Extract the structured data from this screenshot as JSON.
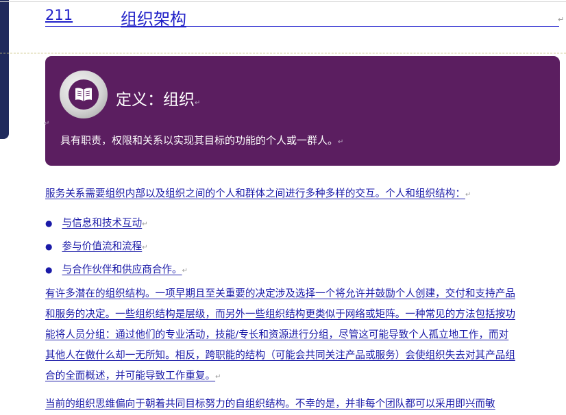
{
  "section": {
    "number": "211",
    "title": "组织架构"
  },
  "definition": {
    "icon": "book-icon",
    "title": "定义：组织",
    "body": "具有职责，权限和关系以实现其目标的功能的个人或一群人。"
  },
  "intro": "服务关系需要组织内部以及组织之间的个人和群体之间进行多种多样的交互。个人和组织结构：",
  "bullets": [
    "与信息和技术互动",
    "参与价值流和流程",
    "与合作伙伴和供应商合作。"
  ],
  "paragraph2": [
    "有许多潜在的组织结构。一项早期且至关重要的决定涉及选择一个将允许并鼓励个人创建，交付和支持产品",
    "和服务的决定。一些组织结构是层级，而另外一些组织结构更类似于网络或矩阵。一种常见的方法包括按功",
    "能将人员分组：通过他们的专业活动，技能/专长和资源进行分组，尽管这可能导致个人孤立地工作，而对",
    "其他人在做什么却一无所知。相反，跨职能的结构（可能会共同关注产品或服务）会使组织失去对其产品组",
    "合的全面概述，并可能导致工作重复。"
  ],
  "paragraph3": "当前的组织思维偏向于朝着共同目标努力的自组织结构。不幸的是，并非每个团队都可以采用即兴而敏",
  "colors": {
    "heading": "#2020c8",
    "text": "#1a1aa8",
    "box": "#5b1e60"
  }
}
